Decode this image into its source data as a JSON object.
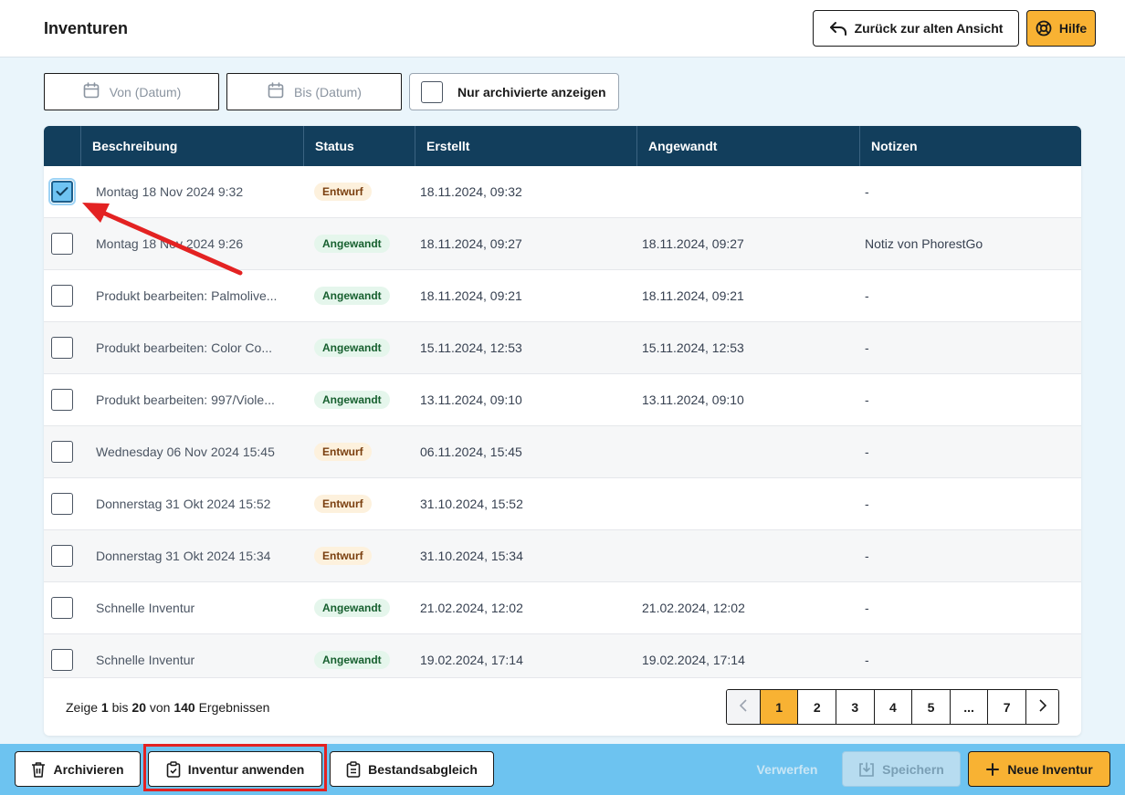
{
  "header": {
    "title": "Inventuren",
    "back_label": "Zurück zur alten Ansicht",
    "help_label": "Hilfe"
  },
  "filters": {
    "from_placeholder": "Von (Datum)",
    "to_placeholder": "Bis (Datum)",
    "archived_label": "Nur archivierte anzeigen"
  },
  "table": {
    "columns": [
      "Beschreibung",
      "Status",
      "Erstellt",
      "Angewandt",
      "Notizen"
    ],
    "rows": [
      {
        "checked": true,
        "description": "Montag 18 Nov 2024 9:32",
        "status": "Entwurf",
        "created": "18.11.2024, 09:32",
        "applied": "",
        "notes": "-"
      },
      {
        "checked": false,
        "description": "Montag 18 Nov 2024 9:26",
        "status": "Angewandt",
        "created": "18.11.2024, 09:27",
        "applied": "18.11.2024, 09:27",
        "notes": "Notiz von PhorestGo"
      },
      {
        "checked": false,
        "description": "Produkt bearbeiten: Palmolive...",
        "status": "Angewandt",
        "created": "18.11.2024, 09:21",
        "applied": "18.11.2024, 09:21",
        "notes": "-"
      },
      {
        "checked": false,
        "description": "Produkt bearbeiten: Color Co...",
        "status": "Angewandt",
        "created": "15.11.2024, 12:53",
        "applied": "15.11.2024, 12:53",
        "notes": "-"
      },
      {
        "checked": false,
        "description": "Produkt bearbeiten: 997/Viole...",
        "status": "Angewandt",
        "created": "13.11.2024, 09:10",
        "applied": "13.11.2024, 09:10",
        "notes": "-"
      },
      {
        "checked": false,
        "description": "Wednesday 06 Nov 2024 15:45",
        "status": "Entwurf",
        "created": "06.11.2024, 15:45",
        "applied": "",
        "notes": "-"
      },
      {
        "checked": false,
        "description": "Donnerstag 31 Okt 2024 15:52",
        "status": "Entwurf",
        "created": "31.10.2024, 15:52",
        "applied": "",
        "notes": "-"
      },
      {
        "checked": false,
        "description": "Donnerstag 31 Okt 2024 15:34",
        "status": "Entwurf",
        "created": "31.10.2024, 15:34",
        "applied": "",
        "notes": "-"
      },
      {
        "checked": false,
        "description": "Schnelle Inventur",
        "status": "Angewandt",
        "created": "21.02.2024, 12:02",
        "applied": "21.02.2024, 12:02",
        "notes": "-"
      },
      {
        "checked": false,
        "description": "Schnelle Inventur",
        "status": "Angewandt",
        "created": "19.02.2024, 17:14",
        "applied": "19.02.2024, 17:14",
        "notes": "-"
      }
    ]
  },
  "footer": {
    "results_prefix": "Zeige",
    "results_from": "1",
    "results_mid1": "bis",
    "results_to": "20",
    "results_mid2": "von",
    "results_total": "140",
    "results_suffix": "Ergebnissen",
    "pages": [
      "1",
      "2",
      "3",
      "4",
      "5",
      "...",
      "7"
    ],
    "active_page": "1"
  },
  "actions": {
    "archive_label": "Archivieren",
    "apply_label": "Inventur anwenden",
    "reconcile_label": "Bestandsabgleich",
    "discard_label": "Verwerfen",
    "save_label": "Speichern",
    "new_label": "Neue Inventur"
  },
  "colors": {
    "header_dark": "#123e5c",
    "accent_yellow": "#f8b233",
    "action_bar": "#6dc3f0",
    "highlight_red": "#e32222"
  }
}
